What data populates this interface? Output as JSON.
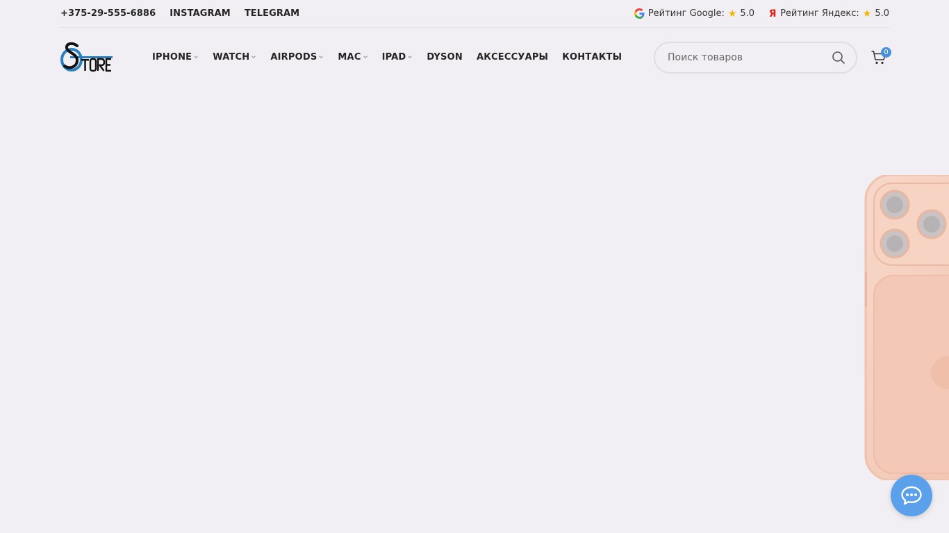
{
  "topbar": {
    "phone": "+375-29-555-6886",
    "instagram": "INSTAGRAM",
    "telegram": "TELEGRAM",
    "google_rating_label": "Рейтинг Google:",
    "google_rating_value": "5.0",
    "yandex_rating_label": "Рейтинг Яндекс:",
    "yandex_rating_value": "5.0"
  },
  "nav": {
    "items": [
      {
        "label": "IPHONE",
        "has_dropdown": true
      },
      {
        "label": "WATCH",
        "has_dropdown": true
      },
      {
        "label": "AIRPODS",
        "has_dropdown": true
      },
      {
        "label": "MAC",
        "has_dropdown": true
      },
      {
        "label": "IPAD",
        "has_dropdown": true
      },
      {
        "label": "DYSON",
        "has_dropdown": false
      },
      {
        "label": "АКСЕССУАРЫ",
        "has_dropdown": false
      },
      {
        "label": "КОНТАКТЫ",
        "has_dropdown": false
      }
    ]
  },
  "search": {
    "placeholder": "Поиск товаров",
    "value": ""
  },
  "cart": {
    "count": "0"
  },
  "icons": {
    "search": "search-icon",
    "cart": "cart-icon",
    "chat": "chat-bubble-icon",
    "star": "star-icon",
    "google": "google-icon",
    "yandex": "yandex-icon",
    "chevron": "chevron-down-icon"
  },
  "colors": {
    "background": "#f1eff3",
    "text": "#242424",
    "accent": "#4a90d9",
    "chat_button": "#5aa0ea",
    "star": "#f4b400",
    "phone_case": "#f2c6b4"
  }
}
